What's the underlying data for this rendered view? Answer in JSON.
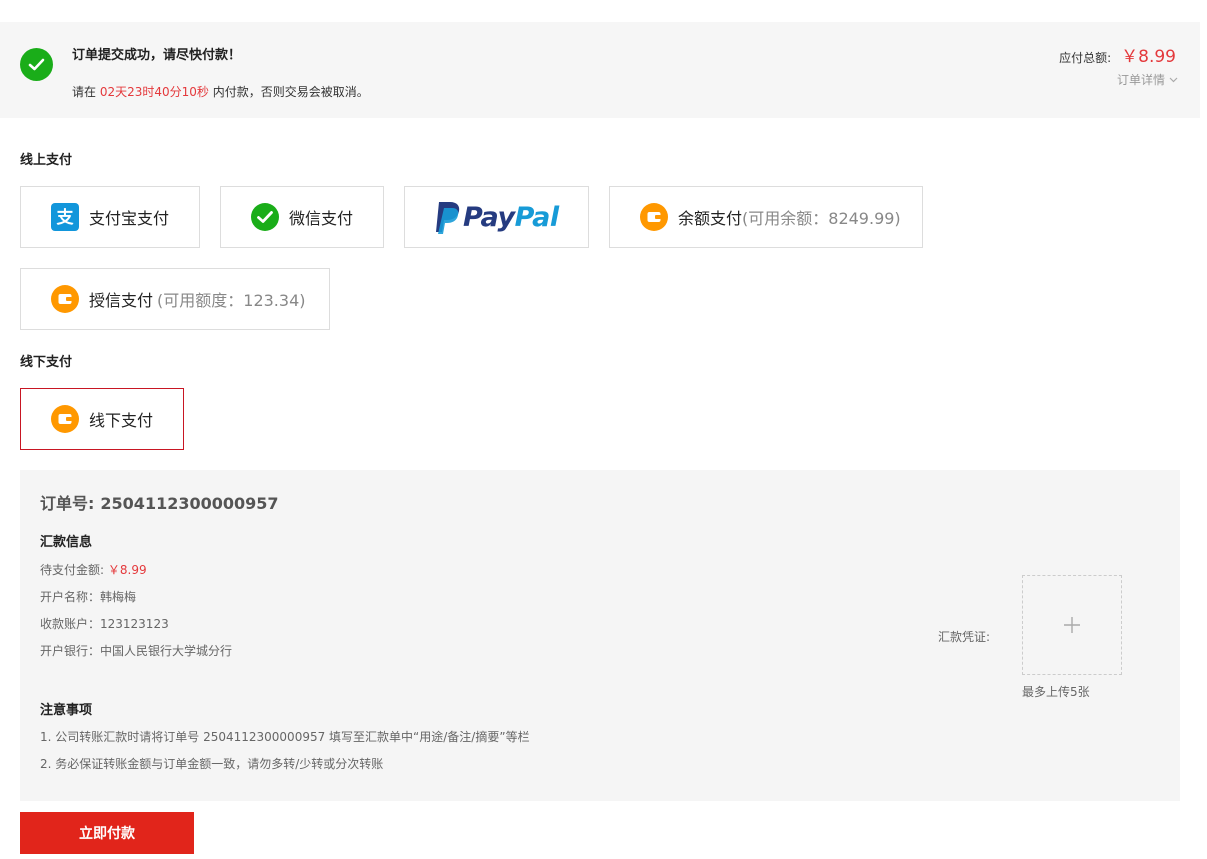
{
  "banner": {
    "title": "订单提交成功，请尽快付款！",
    "sub_prefix": "请在",
    "countdown": "02天23时40分10秒",
    "sub_suffix": "内付款，否则交易会被取消。",
    "total_label": "应付总额:",
    "total_amount": "￥8.99",
    "detail_link": "订单详情"
  },
  "online": {
    "label": "线上支付",
    "options": [
      {
        "label": "支付宝支付",
        "extra": "",
        "icon": "alipay-icon"
      },
      {
        "label": "微信支付",
        "extra": "",
        "icon": "wechat-icon"
      },
      {
        "label": "PayPal",
        "logo_parts": [
          "Pay",
          "Pal"
        ],
        "icon": "paypal-logo"
      },
      {
        "label": "余额支付",
        "extra": "(可用余额：8249.99)",
        "icon": "wallet-icon"
      },
      {
        "label": "授信支付",
        "extra": "(可用额度：123.34)",
        "icon": "wallet-icon"
      }
    ]
  },
  "offline": {
    "label": "线下支付",
    "option": {
      "label": "线下支付",
      "icon": "wallet-icon",
      "selected": true
    }
  },
  "panel": {
    "order_no_label": "订单号:",
    "order_no": "2504112300000957",
    "remit_title": "汇款信息",
    "amount_label": "待支付金额:",
    "amount_value": "￥8.99",
    "account_name": "开户名称：韩梅梅",
    "account_no": "收款账户：123123123",
    "bank": "开户银行：中国人民银行大学城分行",
    "notes_title": "注意事项",
    "note_1": "1. 公司转账汇款时请将订单号 2504112300000957 填写至汇款单中“用途/备注/摘要”等栏",
    "note_2": "2. 务必保证转账金额与订单金额一致，请勿多转/少转或分次转账",
    "voucher_label": "汇款凭证:",
    "upload_hint": "最多上传5张"
  },
  "actions": {
    "pay_now": "立即付款"
  },
  "colors": {
    "accent_red": "#e4393c",
    "button_red": "#e1251b",
    "success_green": "#1aad19",
    "alipay_blue": "#1296db",
    "wallet_orange": "#ff9800"
  }
}
